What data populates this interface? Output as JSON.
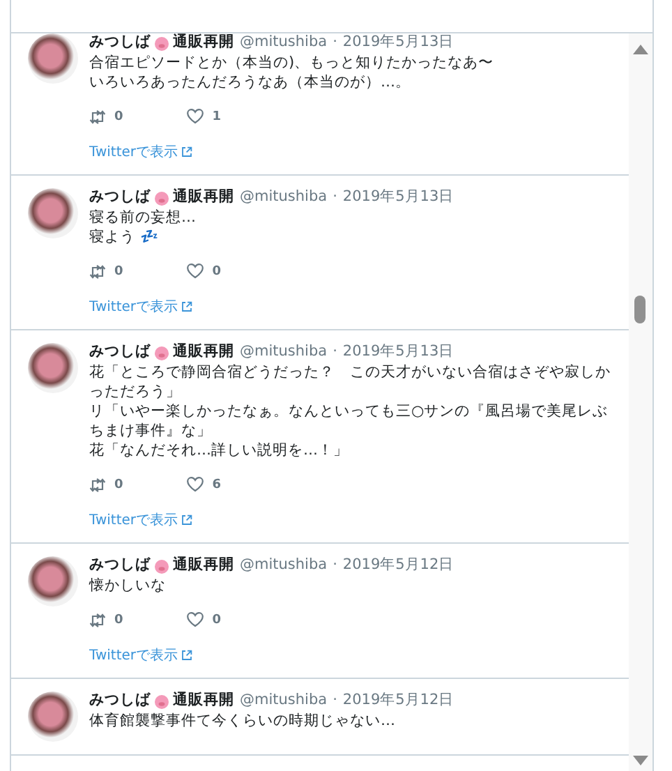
{
  "tweets": [
    {
      "name": "みつしば",
      "name_suffix": "通販再開",
      "handle": "@mitushiba",
      "separator": "·",
      "date": "2019年5月13日",
      "lines": [
        "合宿エピソードとか（本当の)、もっと知りたかったなあ〜",
        "いろいろあったんだろうなあ（本当のが）…。"
      ],
      "retweets": "0",
      "likes": "1",
      "link": "Twitterで表示"
    },
    {
      "name": "みつしば",
      "name_suffix": "通販再開",
      "handle": "@mitushiba",
      "separator": "·",
      "date": "2019年5月13日",
      "lines": [
        "寝る前の妄想…",
        "寝よう 💤"
      ],
      "retweets": "0",
      "likes": "0",
      "link": "Twitterで表示"
    },
    {
      "name": "みつしば",
      "name_suffix": "通販再開",
      "handle": "@mitushiba",
      "separator": "·",
      "date": "2019年5月13日",
      "lines": [
        "花「ところで静岡合宿どうだった？　この天才がいない合宿はさぞや寂しかっただろう」",
        "リ「いやー楽しかったなぁ。なんといっても三○サンの『風呂場で美尾レぶちまけ事件』な」",
        "花「なんだそれ…詳しい説明を…！」"
      ],
      "retweets": "0",
      "likes": "6",
      "link": "Twitterで表示"
    },
    {
      "name": "みつしば",
      "name_suffix": "通販再開",
      "handle": "@mitushiba",
      "separator": "·",
      "date": "2019年5月12日",
      "lines": [
        "懐かしいな"
      ],
      "retweets": "0",
      "likes": "0",
      "link": "Twitterで表示"
    },
    {
      "name": "みつしば",
      "name_suffix": "通販再開",
      "handle": "@mitushiba",
      "separator": "·",
      "date": "2019年5月12日",
      "lines": [
        "体育館襲撃事件て今くらいの時期じゃない…"
      ]
    }
  ]
}
